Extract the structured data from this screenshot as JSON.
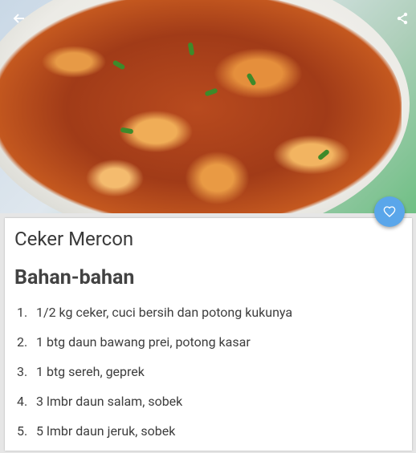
{
  "header": {
    "back_icon": "arrow-left-icon",
    "share_icon": "share-icon"
  },
  "fab": {
    "icon": "heart-outline-icon",
    "color": "#5aa6ea"
  },
  "recipe": {
    "title": "Ceker Mercon",
    "section_title": "Bahan-bahan",
    "ingredients": [
      {
        "num": "1.",
        "text": "1/2 kg ceker, cuci bersih dan potong kukunya"
      },
      {
        "num": "2.",
        "text": "1 btg daun bawang prei, potong kasar"
      },
      {
        "num": "3.",
        "text": "1 btg sereh, geprek"
      },
      {
        "num": "4.",
        "text": "3 lmbr daun salam, sobek"
      },
      {
        "num": "5.",
        "text": "5 lmbr daun jeruk, sobek"
      }
    ]
  }
}
